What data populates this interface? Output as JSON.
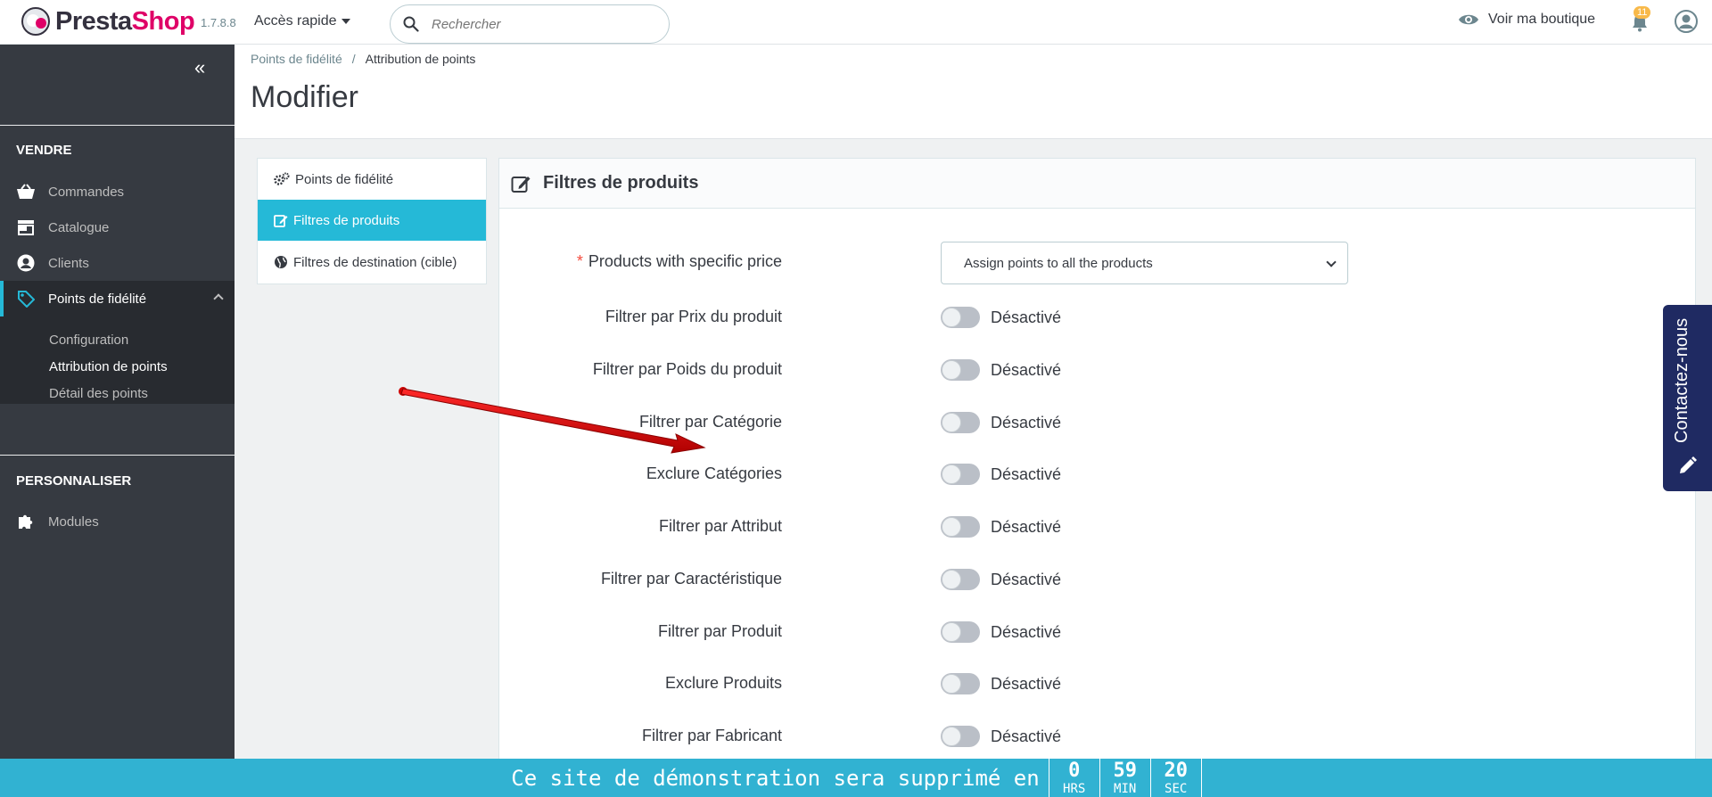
{
  "header": {
    "logo_part1": "Presta",
    "logo_part2": "Shop",
    "version": "1.7.8.8",
    "quick_access": "Accès rapide",
    "search_placeholder": "Rechercher",
    "view_shop": "Voir ma boutique",
    "notifications_count": "11"
  },
  "sidebar": {
    "section_sell": "VENDRE",
    "items": [
      {
        "label": "Commandes",
        "icon": "basket-icon"
      },
      {
        "label": "Catalogue",
        "icon": "store-icon"
      },
      {
        "label": "Clients",
        "icon": "user-icon"
      },
      {
        "label": "Points de fidélité",
        "icon": "tag-icon"
      }
    ],
    "subitems": [
      "Configuration",
      "Attribution de points",
      "Détail des points"
    ],
    "section_customize": "PERSONNALISER",
    "modules": "Modules"
  },
  "breadcrumb": {
    "parent": "Points de fidélité",
    "separator": "/",
    "current": "Attribution de points"
  },
  "page_title": "Modifier",
  "tabs": [
    {
      "label": "Points de fidélité",
      "icon": "cogs-icon"
    },
    {
      "label": "Filtres de produits",
      "icon": "edit-icon"
    },
    {
      "label": "Filtres de destination (cible)",
      "icon": "globe-icon"
    }
  ],
  "panel": {
    "title": "Filtres de produits",
    "specific_price_label": "Products with specific price",
    "required_mark": "*",
    "specific_price_value": "Assign points to all the products",
    "toggle_state": "Désactivé",
    "filters": [
      "Filtrer par Prix du produit",
      "Filtrer par Poids du produit",
      "Filtrer par Catégorie",
      "Exclure Catégories",
      "Filtrer par Attribut",
      "Filtrer par Caractéristique",
      "Filtrer par Produit",
      "Exclure Produits",
      "Filtrer par Fabricant"
    ]
  },
  "contact": {
    "label": "Contactez-nous"
  },
  "bottom_bar": {
    "message": "Ce site de démonstration sera supprimé en",
    "hours": "0",
    "hours_unit": "HRS",
    "minutes": "59",
    "minutes_unit": "MIN",
    "seconds": "20",
    "seconds_unit": "SEC"
  },
  "colors": {
    "accent": "#25b9d7",
    "sidebar": "#363a41",
    "logo_pink": "#df0067",
    "arrow_red": "#e00000"
  }
}
